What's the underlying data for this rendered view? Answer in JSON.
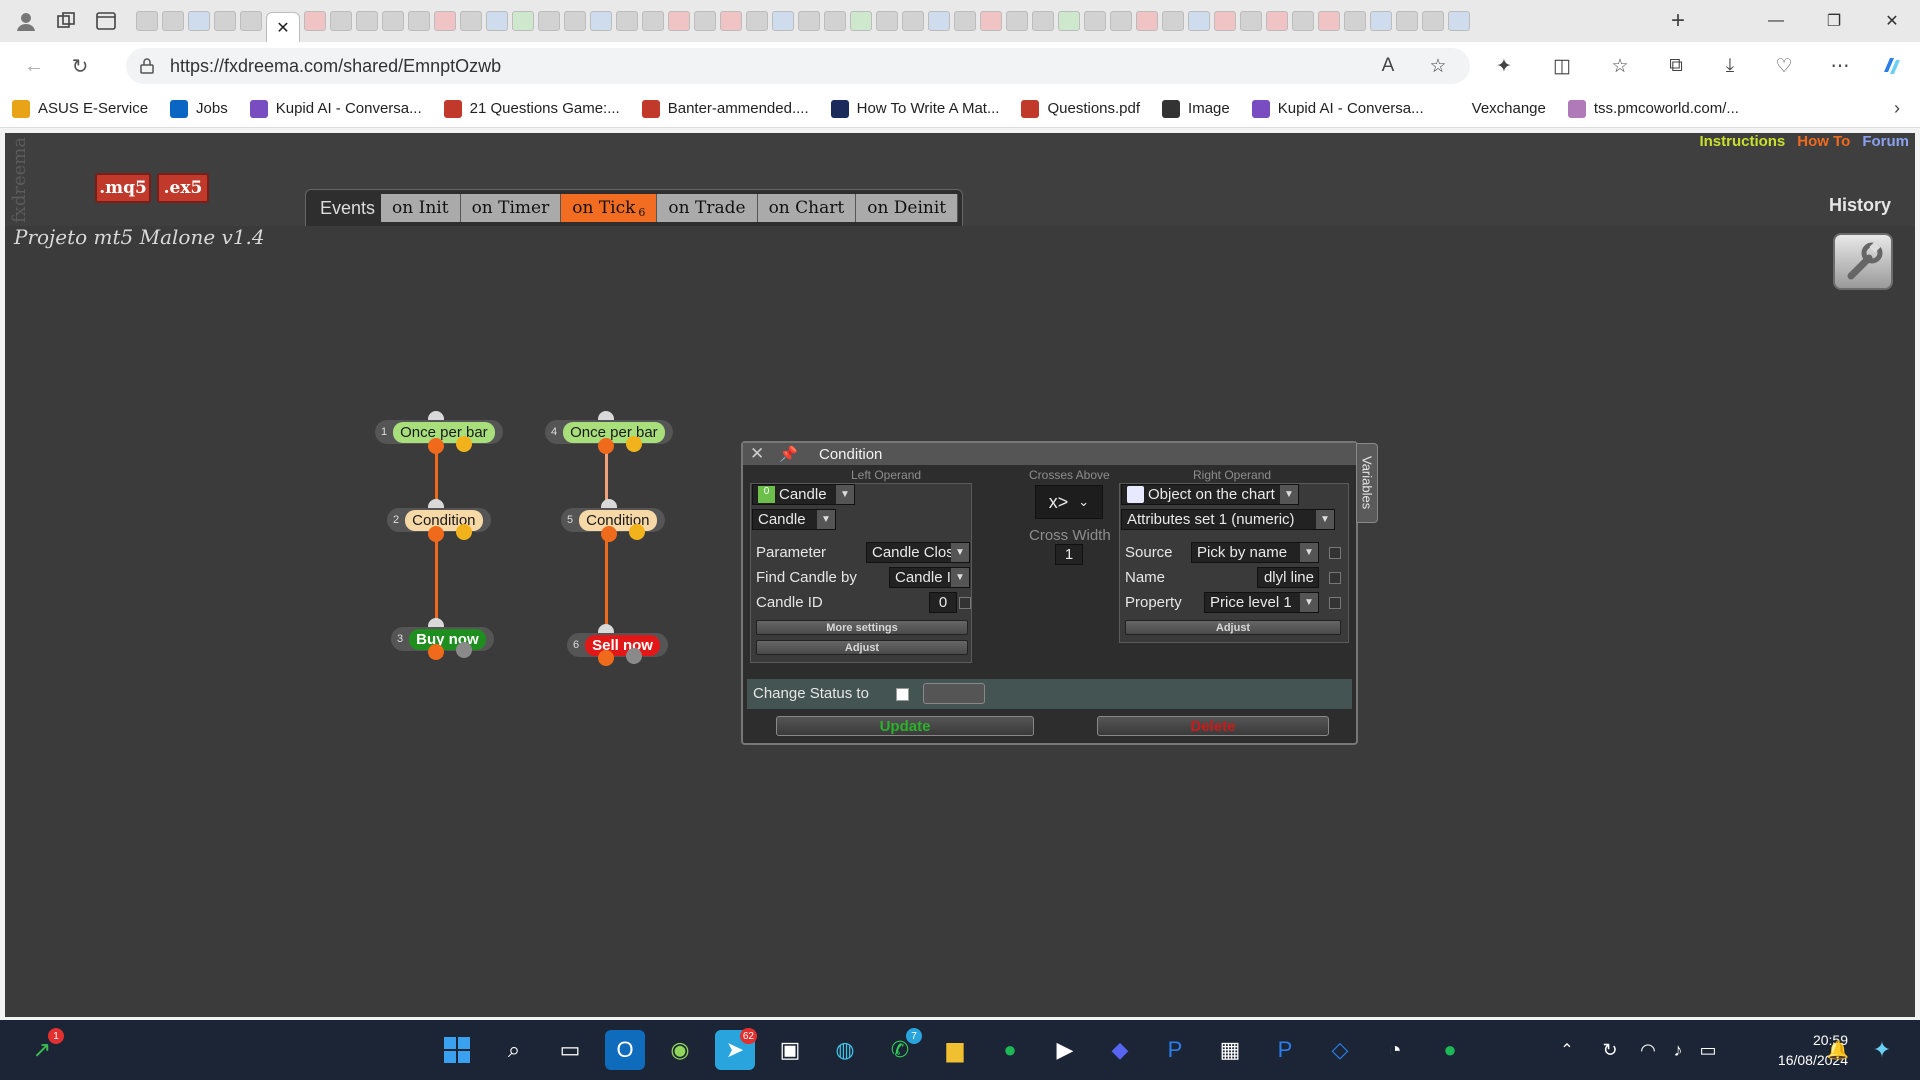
{
  "browser": {
    "url": "https://fxdreema.com/shared/EmnptOzwb",
    "bookmarks": [
      {
        "label": "ASUS E-Service",
        "color": "#e8a317"
      },
      {
        "label": "Jobs",
        "color": "#0a66c2"
      },
      {
        "label": "Kupid AI - Conversa...",
        "color": "#7a4cc2"
      },
      {
        "label": "21 Questions Game:...",
        "color": "#c0392b"
      },
      {
        "label": "Banter-ammended....",
        "color": "#c0392b"
      },
      {
        "label": "How To Write A Mat...",
        "color": "#1a2a5a"
      },
      {
        "label": "Questions.pdf",
        "color": "#c0392b"
      },
      {
        "label": "Image",
        "color": "#333333"
      },
      {
        "label": "Kupid AI - Conversa...",
        "color": "#7a4cc2"
      },
      {
        "label": "Vexchange",
        "color": "#ffffff"
      },
      {
        "label": "tss.pmcoworld.com/...",
        "color": "#b07ab8"
      }
    ]
  },
  "app": {
    "vertical_logo": "fxdreema",
    "file_buttons": {
      "mq5": ".mq5",
      "ex5": ".ex5"
    },
    "top_links": {
      "instructions": "Instructions",
      "howto": "How To",
      "forum": "Forum"
    },
    "history": "History",
    "project_title": "Projeto mt5 Malone v1.4",
    "events_label": "Events",
    "tabs": [
      {
        "label": "on Init",
        "sub": ""
      },
      {
        "label": "on Timer",
        "sub": ""
      },
      {
        "label": "on Tick",
        "sub": "6"
      },
      {
        "label": "on Trade",
        "sub": ""
      },
      {
        "label": "on Chart",
        "sub": ""
      },
      {
        "label": "on Deinit",
        "sub": ""
      }
    ],
    "blocks": [
      {
        "num": "1",
        "label": "Once per bar"
      },
      {
        "num": "2",
        "label": "Condition"
      },
      {
        "num": "3",
        "label": "Buy now"
      },
      {
        "num": "4",
        "label": "Once per bar"
      },
      {
        "num": "5",
        "label": "Condition"
      },
      {
        "num": "6",
        "label": "Sell now"
      }
    ]
  },
  "dialog": {
    "title": "Condition",
    "left_caption": "Left Operand",
    "middle_caption": "Crosses Above",
    "right_caption": "Right Operand",
    "left": {
      "type": "Candle",
      "subtype": "Candle",
      "parameter_label": "Parameter",
      "parameter_value": "Candle Close",
      "find_label": "Find Candle by",
      "find_value": "Candle ID",
      "id_label": "Candle ID",
      "id_value": "0",
      "more_settings": "More settings",
      "adjust": "Adjust"
    },
    "operator": "x>",
    "cross_width_label": "Cross Width",
    "cross_width_value": "1",
    "right": {
      "type": "Object on the chart",
      "subtype": "Attributes set 1 (numeric)",
      "source_label": "Source",
      "source_value": "Pick by name",
      "name_label": "Name",
      "name_value": "dlyl line",
      "property_label": "Property",
      "property_value": "Price level 1",
      "adjust": "Adjust"
    },
    "status_label": "Change Status to",
    "update": "Update",
    "delete": "Delete",
    "variables_tab": "Variables"
  },
  "taskbar": {
    "time": "20:59",
    "date": "16/08/2024",
    "badges": {
      "stocks": "1",
      "telegram": "62",
      "whatsapp": "7"
    }
  }
}
